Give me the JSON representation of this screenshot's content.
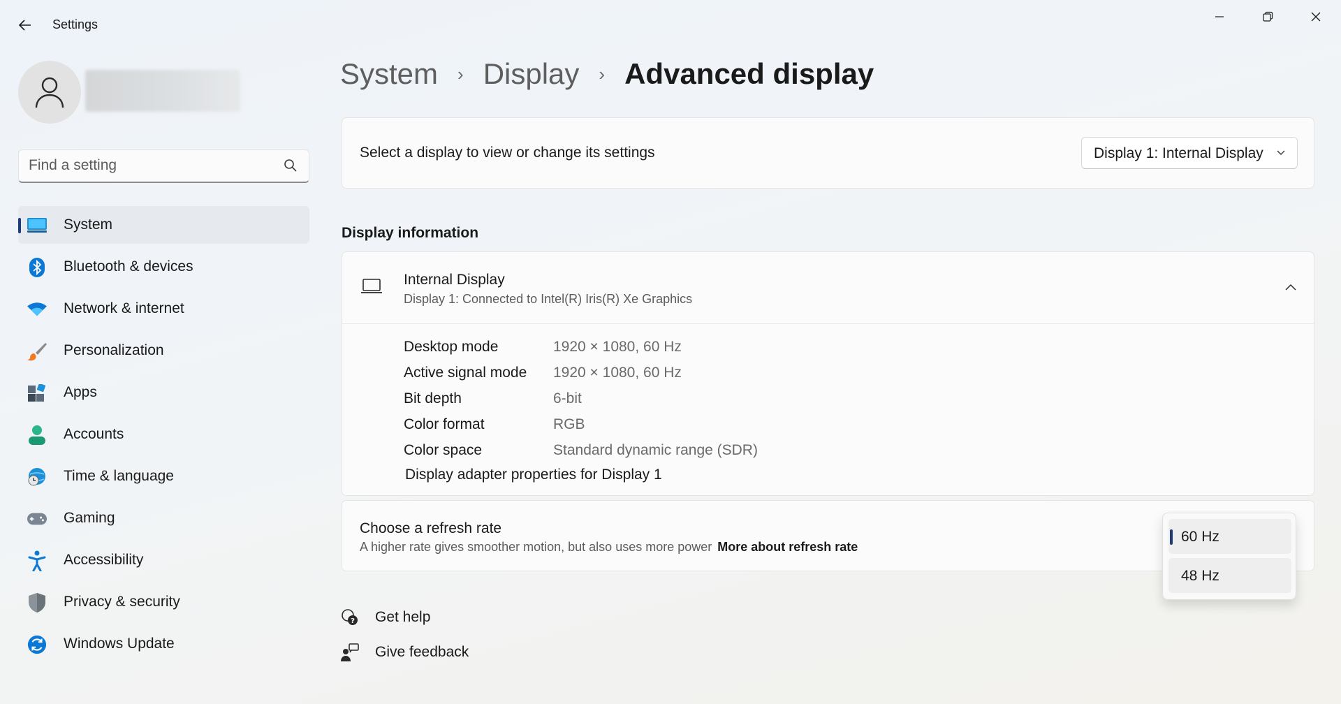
{
  "window": {
    "title": "Settings"
  },
  "search": {
    "placeholder": "Find a setting"
  },
  "sidebar": {
    "items": [
      {
        "label": "System",
        "icon": "system-icon",
        "selected": true
      },
      {
        "label": "Bluetooth & devices",
        "icon": "bluetooth-icon"
      },
      {
        "label": "Network & internet",
        "icon": "wifi-icon"
      },
      {
        "label": "Personalization",
        "icon": "brush-icon"
      },
      {
        "label": "Apps",
        "icon": "apps-icon"
      },
      {
        "label": "Accounts",
        "icon": "person-icon"
      },
      {
        "label": "Time & language",
        "icon": "globe-clock-icon"
      },
      {
        "label": "Gaming",
        "icon": "gamepad-icon"
      },
      {
        "label": "Accessibility",
        "icon": "accessibility-icon"
      },
      {
        "label": "Privacy & security",
        "icon": "shield-icon"
      },
      {
        "label": "Windows Update",
        "icon": "update-icon"
      }
    ]
  },
  "breadcrumb": {
    "items": [
      "System",
      "Display",
      "Advanced display"
    ]
  },
  "display_select": {
    "label": "Select a display to view or change its settings",
    "value": "Display 1: Internal Display"
  },
  "display_info": {
    "section_title": "Display information",
    "title": "Internal Display",
    "subtitle": "Display 1: Connected to Intel(R) Iris(R) Xe Graphics",
    "rows": [
      {
        "key": "Desktop mode",
        "value": "1920 × 1080, 60 Hz"
      },
      {
        "key": "Active signal mode",
        "value": "1920 × 1080, 60 Hz"
      },
      {
        "key": "Bit depth",
        "value": "6-bit"
      },
      {
        "key": "Color format",
        "value": "RGB"
      },
      {
        "key": "Color space",
        "value": "Standard dynamic range (SDR)"
      }
    ],
    "adapter_link": "Display adapter properties for Display 1"
  },
  "refresh_rate": {
    "title": "Choose a refresh rate",
    "description": "A higher rate gives smoother motion, but also uses more power",
    "link": "More about refresh rate",
    "options": [
      "60 Hz",
      "48 Hz"
    ],
    "selected": "60 Hz"
  },
  "help": {
    "get_help": "Get help",
    "give_feedback": "Give feedback"
  },
  "colors": {
    "accent": "#1f3b78",
    "system_icon": "#1e90d6"
  }
}
